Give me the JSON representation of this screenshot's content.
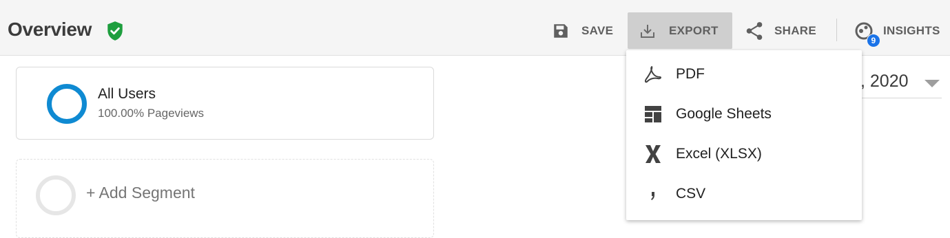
{
  "header": {
    "title": "Overview",
    "toolbar": {
      "save_label": "SAVE",
      "export_label": "EXPORT",
      "share_label": "SHARE",
      "insights_label": "INSIGHTS",
      "insights_badge": "9"
    }
  },
  "segments": {
    "active": {
      "name": "All Users",
      "detail": "100.00% Pageviews",
      "color": "#0f8ad2"
    },
    "add_label": "+ Add Segment"
  },
  "date_range": {
    "visible_text": ", 2020"
  },
  "export_menu": {
    "items": [
      {
        "label": "PDF",
        "icon": "pdf-icon"
      },
      {
        "label": "Google Sheets",
        "icon": "google-sheets-icon"
      },
      {
        "label": "Excel (XLSX)",
        "icon": "excel-icon"
      },
      {
        "label": "CSV",
        "icon": "csv-icon"
      }
    ]
  },
  "colors": {
    "verified_green": "#1e9e3e",
    "insights_blue": "#1a73e8",
    "export_active_bg": "#cfcfcf"
  }
}
